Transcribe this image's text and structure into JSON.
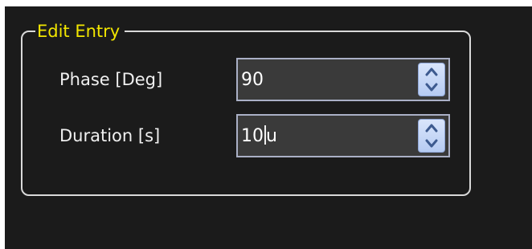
{
  "group": {
    "title": "Edit Entry"
  },
  "fields": [
    {
      "label": "Phase [Deg]",
      "value": "90",
      "up_icon": "chevron-up-icon",
      "down_icon": "chevron-down-icon"
    },
    {
      "label": "Duration [s]",
      "value": "10",
      "unit_suffix": "u",
      "up_icon": "chevron-up-icon",
      "down_icon": "chevron-down-icon"
    }
  ],
  "colors": {
    "background": "#1b1b1b",
    "group_title": "#f2e600",
    "label": "#f0f0f0",
    "input_bg": "#3a3a3a",
    "input_border": "#aab0c6",
    "spin_button": "#c9d9f7"
  }
}
